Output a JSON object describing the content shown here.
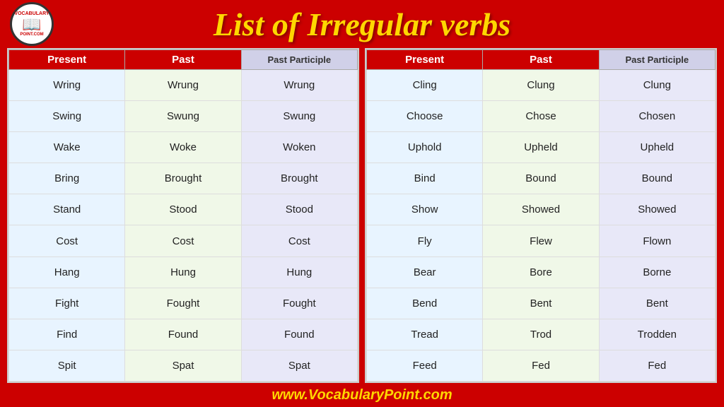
{
  "header": {
    "title": "List of Irregular verbs",
    "logo_top": "VOCABULARY",
    "logo_mid": "📖",
    "logo_bottom": "POINT.COM"
  },
  "footer": {
    "url": "www.VocabularyPoint.com"
  },
  "left_table": {
    "headers": [
      "Present",
      "Past",
      "Past Participle"
    ],
    "rows": [
      [
        "Wring",
        "Wrung",
        "Wrung"
      ],
      [
        "Swing",
        "Swung",
        "Swung"
      ],
      [
        "Wake",
        "Woke",
        "Woken"
      ],
      [
        "Bring",
        "Brought",
        "Brought"
      ],
      [
        "Stand",
        "Stood",
        "Stood"
      ],
      [
        "Cost",
        "Cost",
        "Cost"
      ],
      [
        "Hang",
        "Hung",
        "Hung"
      ],
      [
        "Fight",
        "Fought",
        "Fought"
      ],
      [
        "Find",
        "Found",
        "Found"
      ],
      [
        "Spit",
        "Spat",
        "Spat"
      ]
    ]
  },
  "right_table": {
    "headers": [
      "Present",
      "Past",
      "Past Participle"
    ],
    "rows": [
      [
        "Cling",
        "Clung",
        "Clung"
      ],
      [
        "Choose",
        "Chose",
        "Chosen"
      ],
      [
        "Uphold",
        "Upheld",
        "Upheld"
      ],
      [
        "Bind",
        "Bound",
        "Bound"
      ],
      [
        "Show",
        "Showed",
        "Showed"
      ],
      [
        "Fly",
        "Flew",
        "Flown"
      ],
      [
        "Bear",
        "Bore",
        "Borne"
      ],
      [
        "Bend",
        "Bent",
        "Bent"
      ],
      [
        "Tread",
        "Trod",
        "Trodden"
      ],
      [
        "Feed",
        "Fed",
        "Fed"
      ]
    ]
  }
}
